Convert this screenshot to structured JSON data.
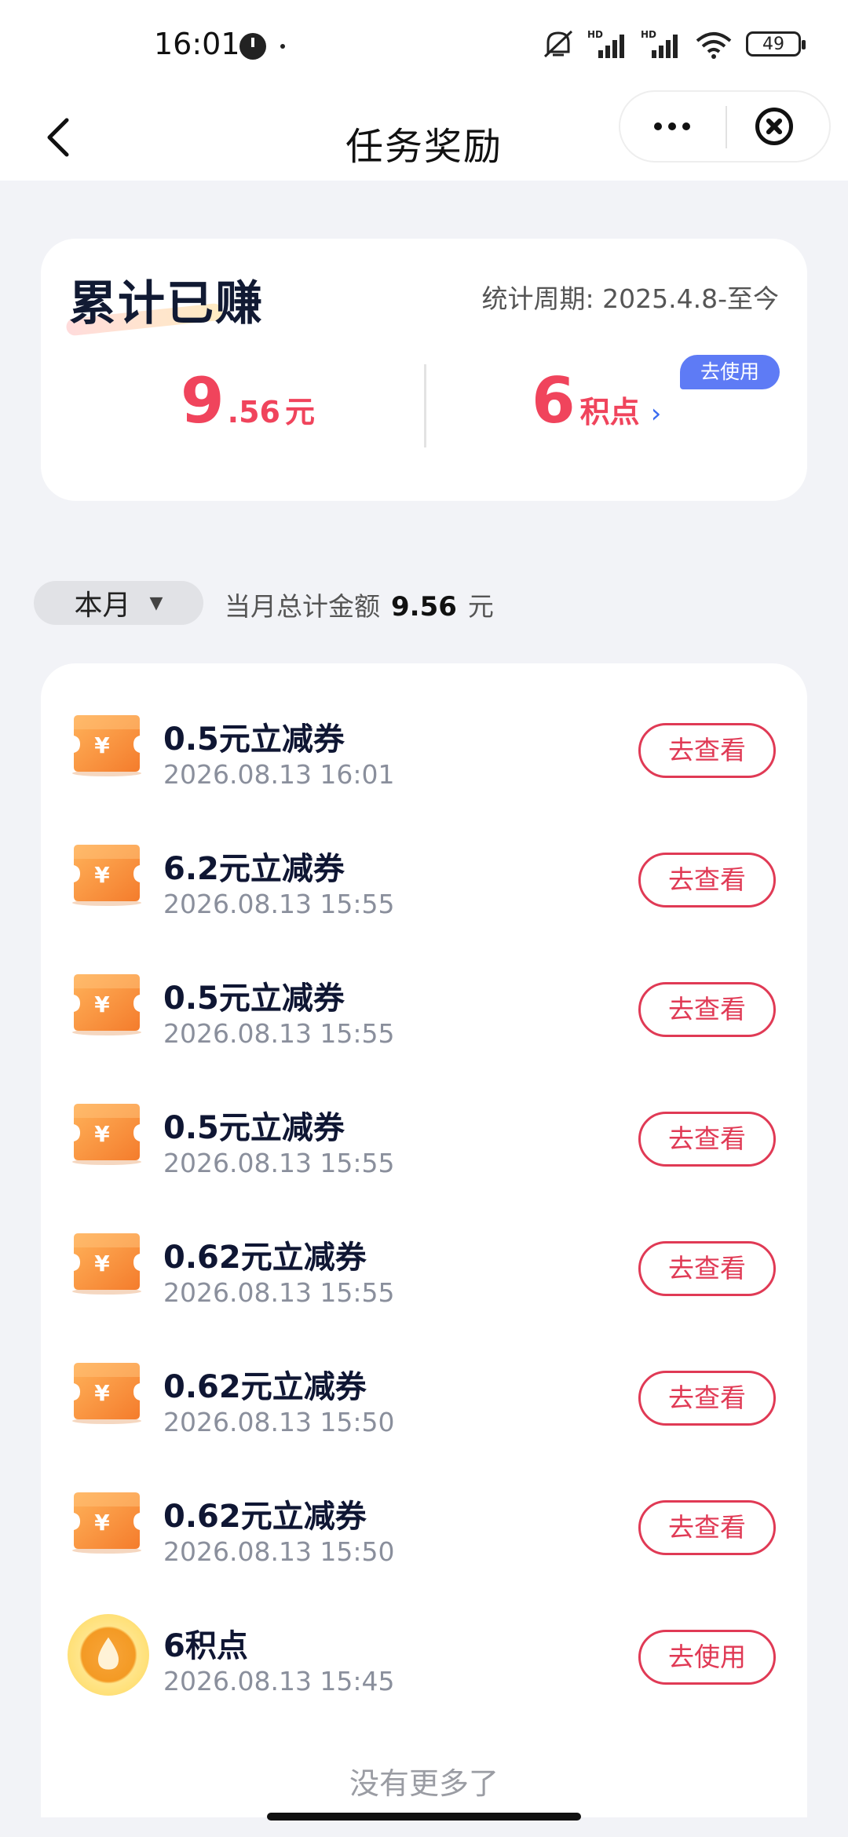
{
  "status_bar": {
    "time": "16:01",
    "battery": "49",
    "icons": [
      "alarm-icon",
      "mute-icon",
      "hd-signal-icon",
      "hd-signal-icon",
      "wifi-icon",
      "battery-icon"
    ]
  },
  "nav": {
    "title": "任务奖励",
    "back_icon": "chevron-left-icon",
    "more_icon": "more-icon",
    "close_icon": "close-circle-icon"
  },
  "summary": {
    "title": "累计已赚",
    "period": "统计周期: 2025.4.8-至今",
    "cash_int": "9",
    "cash_dec": ".56",
    "cash_unit": "元",
    "points_int": "6",
    "points_unit": "积点",
    "points_chevron": "›",
    "use_badge": "去使用"
  },
  "filter": {
    "month_label": "本月",
    "month_arrow": "▼",
    "total_label": "当月总计金额",
    "total_value": "9.56",
    "total_unit": "元"
  },
  "rewards": [
    {
      "title": "0.5元立减券",
      "time": "2026.08.13 16:01",
      "action": "去查看",
      "icon": "coupon-icon"
    },
    {
      "title": "6.2元立减券",
      "time": "2026.08.13 15:55",
      "action": "去查看",
      "icon": "coupon-icon"
    },
    {
      "title": "0.5元立减券",
      "time": "2026.08.13 15:55",
      "action": "去查看",
      "icon": "coupon-icon"
    },
    {
      "title": "0.5元立减券",
      "time": "2026.08.13 15:55",
      "action": "去查看",
      "icon": "coupon-icon"
    },
    {
      "title": "0.62元立减券",
      "time": "2026.08.13 15:55",
      "action": "去查看",
      "icon": "coupon-icon"
    },
    {
      "title": "0.62元立减券",
      "time": "2026.08.13 15:50",
      "action": "去查看",
      "icon": "coupon-icon"
    },
    {
      "title": "0.62元立减券",
      "time": "2026.08.13 15:50",
      "action": "去查看",
      "icon": "coupon-icon"
    },
    {
      "title": "6积点",
      "time": "2026.08.13 15:45",
      "action": "去使用",
      "icon": "points-drop-icon"
    }
  ],
  "footer": {
    "no_more": "没有更多了"
  },
  "colors": {
    "accent_red": "#f0445c",
    "button_red": "#e03a55",
    "badge_blue": "#5e7bf5",
    "coupon_orange": "#f7923a",
    "background": "#f2f3f7"
  }
}
